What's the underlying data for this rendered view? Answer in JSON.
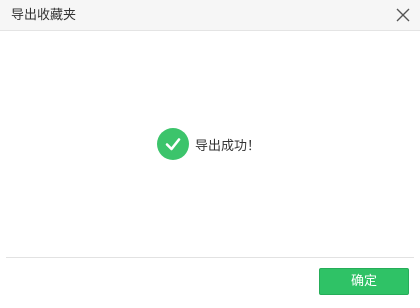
{
  "dialog": {
    "title": "导出收藏夹",
    "close_icon": "close-icon",
    "message": "导出成功！",
    "status_icon": "check-circle-icon",
    "ok_label": "确定"
  },
  "colors": {
    "success": "#3cc46b",
    "button": "#2fc266",
    "titlebar": "#f6f6f6"
  }
}
